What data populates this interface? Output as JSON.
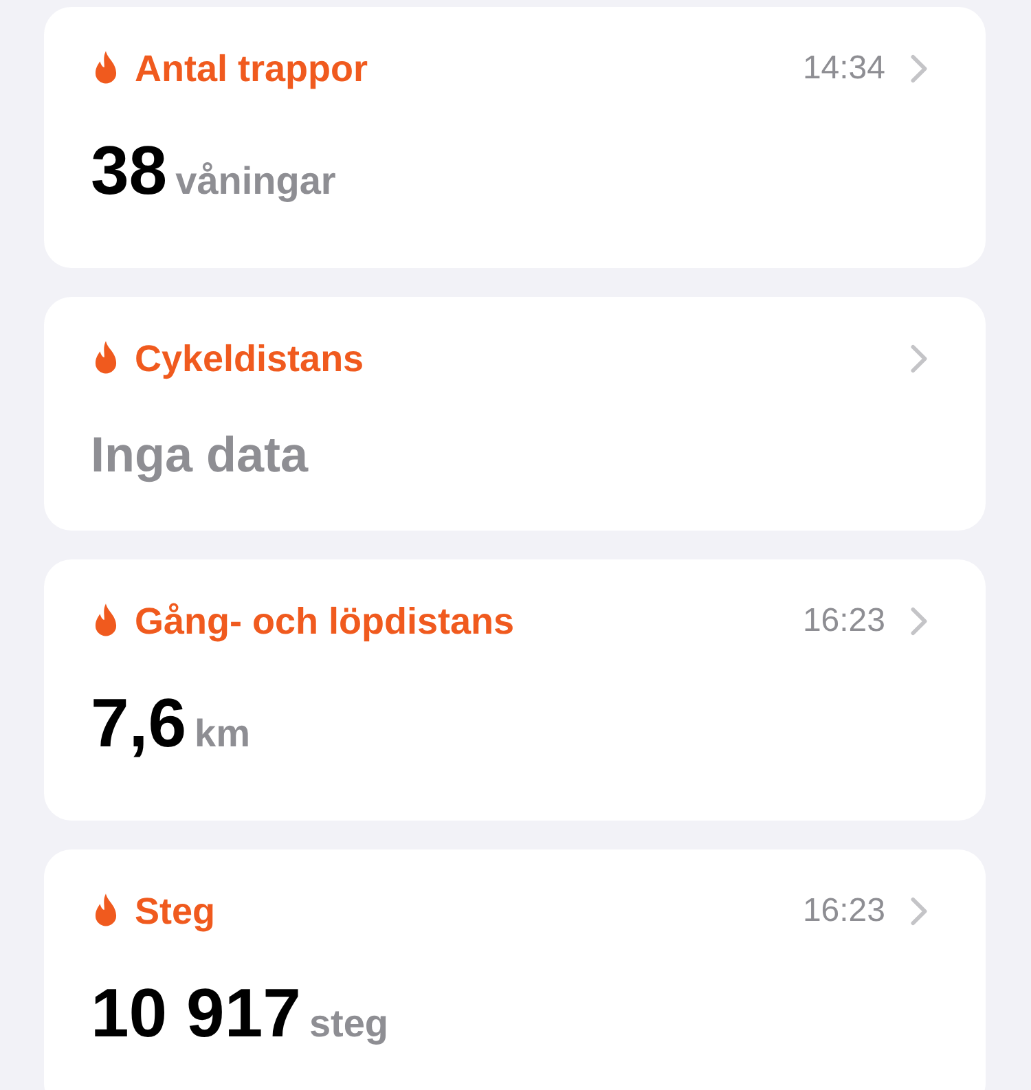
{
  "cards": [
    {
      "kind": "value",
      "title": "Antal trappor",
      "time": "14:34",
      "value": "38",
      "unit": "våningar"
    },
    {
      "kind": "empty",
      "title": "Cykeldistans",
      "text": "Inga data"
    },
    {
      "kind": "value",
      "title": "Gång- och löpdistans",
      "time": "16:23",
      "value": "7,6",
      "unit": "km"
    },
    {
      "kind": "value",
      "title": "Steg",
      "time": "16:23",
      "value": "10 917",
      "unit": "steg"
    }
  ]
}
